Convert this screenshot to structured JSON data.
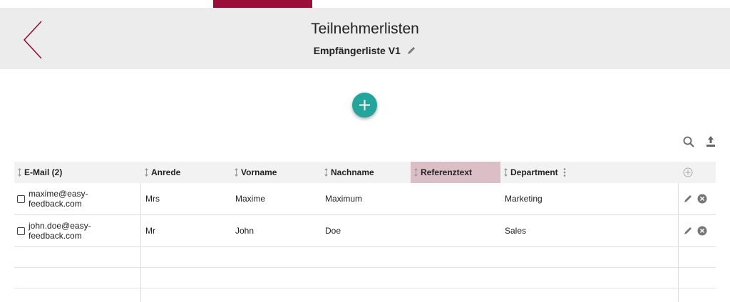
{
  "header": {
    "title": "Teilnehmerlisten",
    "subtitle": "Empfängerliste V1"
  },
  "colors": {
    "accent": "#9a0f3a",
    "add_button": "#24a59c",
    "header_bg": "#ececec",
    "highlight_column": "#dbbec6"
  },
  "icons": {
    "back": "chevron-left-icon",
    "edit": "pencil-icon",
    "add": "plus-icon",
    "search": "search-icon",
    "upload": "upload-icon",
    "add_column": "add-circle-icon",
    "delete": "delete-circle-icon",
    "sort": "sort-arrows-icon",
    "menu": "vertical-dots-icon"
  },
  "table": {
    "columns": [
      "E-Mail (2)",
      "Anrede",
      "Vorname",
      "Nachname",
      "Referenztext",
      "Department"
    ],
    "rows": [
      {
        "email_line1": "maxime@easy-",
        "email_line2": "feedback.com",
        "anrede": "Mrs",
        "vorname": "Maxime",
        "nachname": "Maximum",
        "referenztext": "",
        "department": "Marketing"
      },
      {
        "email_line1": "john.doe@easy-",
        "email_line2": "feedback.com",
        "anrede": "Mr",
        "vorname": "John",
        "nachname": "Doe",
        "referenztext": "",
        "department": "Sales"
      }
    ]
  }
}
